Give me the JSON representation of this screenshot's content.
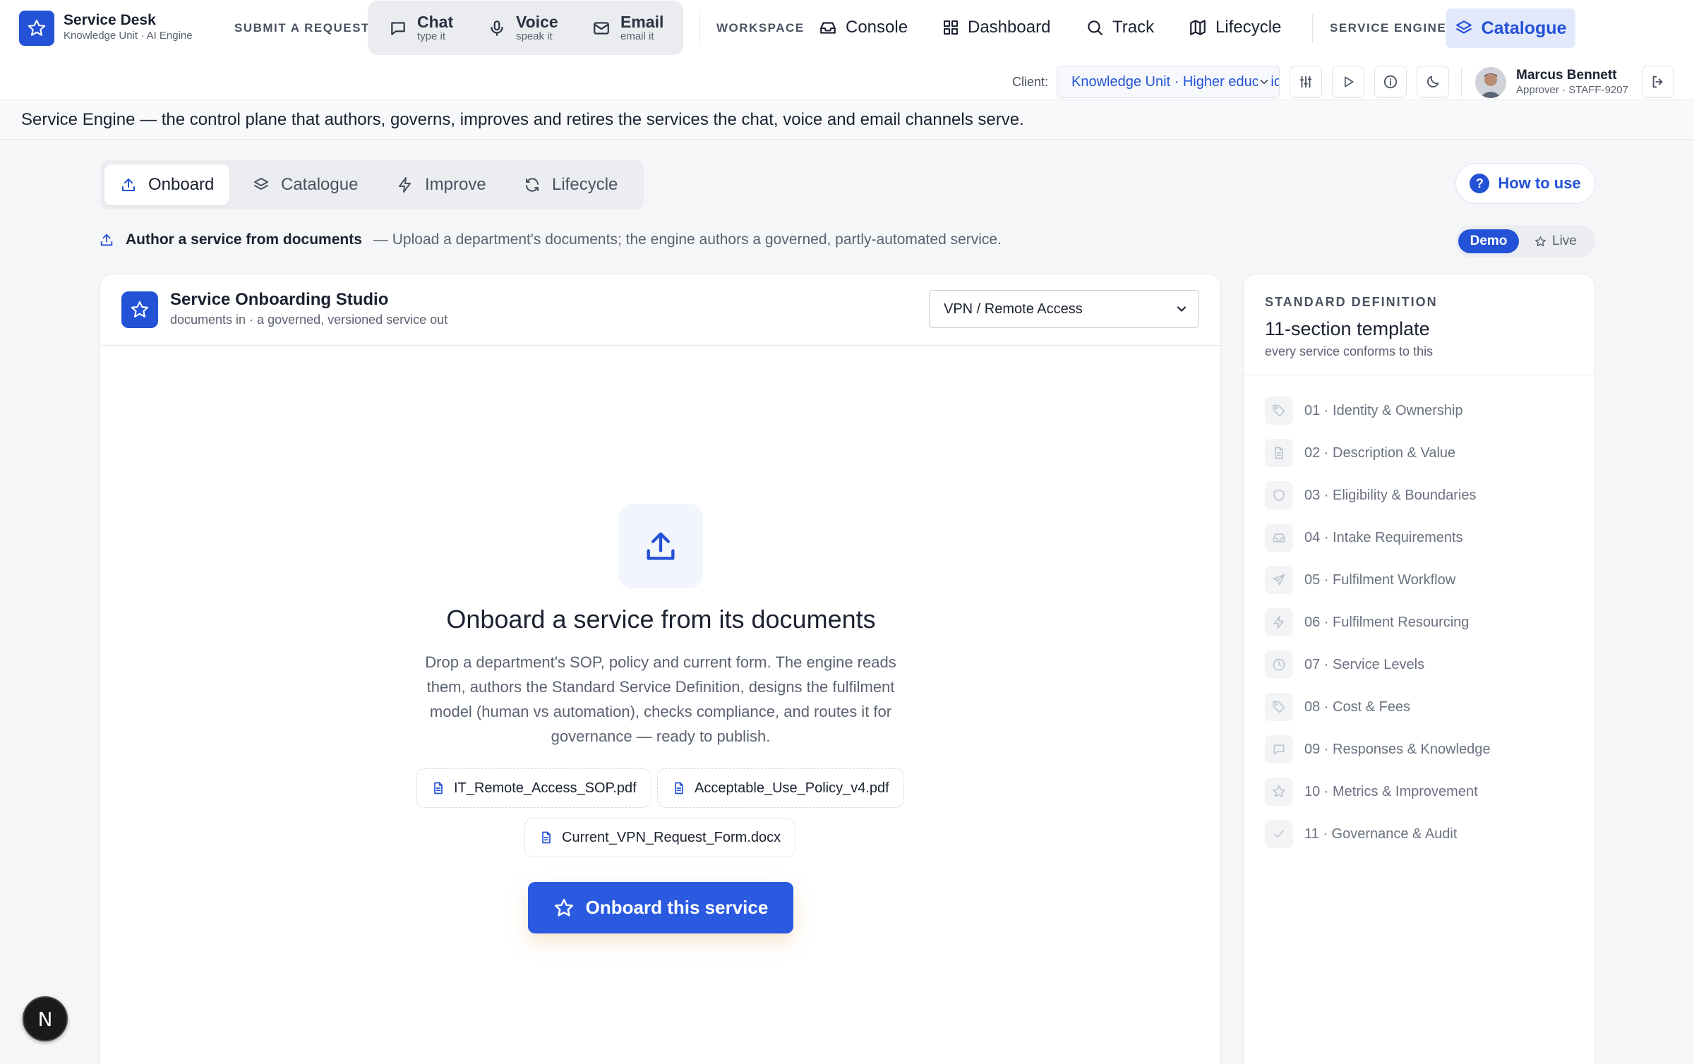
{
  "brand": {
    "title": "Service Desk",
    "subtitle": "Knowledge Unit · AI Engine"
  },
  "topnav": {
    "submit_label": "SUBMIT A REQUEST",
    "channels": [
      {
        "label": "Chat",
        "sub": "type it",
        "icon": "chat-icon"
      },
      {
        "label": "Voice",
        "sub": "speak it",
        "icon": "mic-icon"
      },
      {
        "label": "Email",
        "sub": "email it",
        "icon": "mail-icon"
      }
    ],
    "workspace_label": "WORKSPACE",
    "workspace_items": [
      {
        "label": "Console",
        "icon": "inbox-icon"
      },
      {
        "label": "Dashboard",
        "icon": "grid-icon"
      },
      {
        "label": "Track",
        "icon": "search-icon"
      },
      {
        "label": "Lifecycle",
        "icon": "map-icon"
      }
    ],
    "engine_label": "SERVICE ENGINE",
    "engine_item": {
      "label": "Catalogue",
      "icon": "layers-icon"
    }
  },
  "toolbar": {
    "client_label": "Client:",
    "client_value": "Knowledge Unit · Higher education"
  },
  "user": {
    "name": "Marcus Bennett",
    "role": "Approver · STAFF-9207"
  },
  "banner": "Service Engine — the control plane that authors, governs, improves and retires the services the chat, voice and email channels serve.",
  "tabs": [
    {
      "label": "Onboard",
      "icon": "upload-icon",
      "active": true
    },
    {
      "label": "Catalogue",
      "icon": "layers-icon",
      "active": false
    },
    {
      "label": "Improve",
      "icon": "bolt-icon",
      "active": false
    },
    {
      "label": "Lifecycle",
      "icon": "refresh-icon",
      "active": false
    }
  ],
  "how_to_use": "How to use",
  "subheading": {
    "title": "Author a service from documents",
    "desc": "— Upload a department's documents; the engine authors a governed, partly-automated service."
  },
  "mode": {
    "demo": "Demo",
    "live": "Live",
    "selected": "Demo"
  },
  "studio": {
    "title": "Service Onboarding Studio",
    "subtitle": "documents in · a governed, versioned service out",
    "selected_service": "VPN / Remote Access",
    "hero_title": "Onboard a service from its documents",
    "hero_body": "Drop a department's SOP, policy and current form. The engine reads them, authors the Standard Service Definition, designs the fulfilment model (human vs automation), checks compliance, and routes it for governance — ready to publish.",
    "documents": [
      "IT_Remote_Access_SOP.pdf",
      "Acceptable_Use_Policy_v4.pdf",
      "Current_VPN_Request_Form.docx"
    ],
    "cta": "Onboard this service"
  },
  "standard": {
    "eyebrow": "STANDARD DEFINITION",
    "title": "11-section template",
    "subtitle": "every service conforms to this",
    "sections": [
      {
        "label": "01 · Identity & Ownership",
        "icon": "tag-icon"
      },
      {
        "label": "02 · Description & Value",
        "icon": "file-icon"
      },
      {
        "label": "03 · Eligibility & Boundaries",
        "icon": "shield-icon"
      },
      {
        "label": "04 · Intake Requirements",
        "icon": "inbox-icon"
      },
      {
        "label": "05 · Fulfilment Workflow",
        "icon": "send-icon"
      },
      {
        "label": "06 · Fulfilment Resourcing",
        "icon": "bolt-icon"
      },
      {
        "label": "07 · Service Levels",
        "icon": "clock-icon"
      },
      {
        "label": "08 · Cost & Fees",
        "icon": "tag-icon"
      },
      {
        "label": "09 · Responses & Knowledge",
        "icon": "chat-icon"
      },
      {
        "label": "10 · Metrics & Improvement",
        "icon": "star-icon"
      },
      {
        "label": "11 · Governance & Audit",
        "icon": "check-icon"
      }
    ]
  },
  "badge": "N",
  "colors": {
    "accent": "#2452d6",
    "accent_bg": "#e1e9fb"
  }
}
